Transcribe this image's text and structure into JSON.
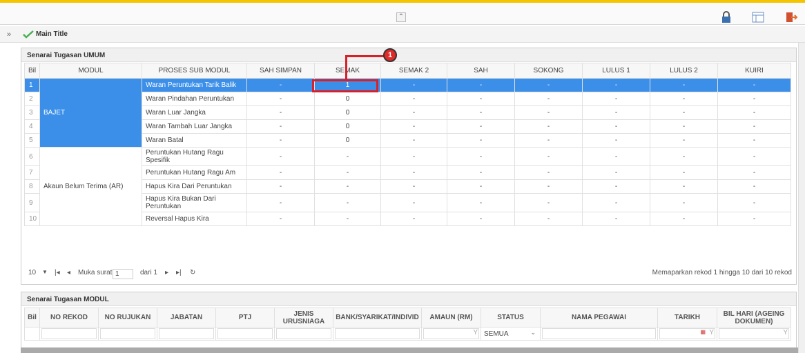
{
  "topbar": {
    "collapse_icon": "double-chevron-up-icon",
    "icons": [
      "lock-icon",
      "layout-icon",
      "logout-icon"
    ]
  },
  "titlebar": {
    "title": "Main Title",
    "expand_glyph": "»"
  },
  "panel1": {
    "title": "Senarai Tugasan UMUM",
    "headers": [
      "Bil",
      "MODUL",
      "PROSES SUB MODUL",
      "SAH SIMPAN",
      "SEMAK",
      "SEMAK 2",
      "SAH",
      "SOKONG",
      "LULUS 1",
      "LULUS 2",
      "KUIRI"
    ],
    "groups": [
      {
        "name": "BAJET"
      },
      {
        "name": "Akaun Belum Terima (AR)"
      }
    ],
    "rows": [
      {
        "bil": "1",
        "proses": "Waran Peruntukan Tarik Balik",
        "vals": [
          "-",
          "1",
          "-",
          "-",
          "-",
          "-",
          "-",
          "-"
        ]
      },
      {
        "bil": "2",
        "proses": "Waran Pindahan Peruntukan",
        "vals": [
          "-",
          "0",
          "-",
          "-",
          "-",
          "-",
          "-",
          "-"
        ]
      },
      {
        "bil": "3",
        "proses": "Waran Luar Jangka",
        "vals": [
          "-",
          "0",
          "-",
          "-",
          "-",
          "-",
          "-",
          "-"
        ]
      },
      {
        "bil": "4",
        "proses": "Waran Tambah Luar Jangka",
        "vals": [
          "-",
          "0",
          "-",
          "-",
          "-",
          "-",
          "-",
          "-"
        ]
      },
      {
        "bil": "5",
        "proses": "Waran Batal",
        "vals": [
          "-",
          "0",
          "-",
          "-",
          "-",
          "-",
          "-",
          "-"
        ]
      },
      {
        "bil": "6",
        "proses": "Peruntukan Hutang Ragu Spesifik",
        "vals": [
          "-",
          "-",
          "-",
          "-",
          "-",
          "-",
          "-",
          "-"
        ]
      },
      {
        "bil": "7",
        "proses": "Peruntukan Hutang Ragu Am",
        "vals": [
          "-",
          "-",
          "-",
          "-",
          "-",
          "-",
          "-",
          "-"
        ]
      },
      {
        "bil": "8",
        "proses": "Hapus Kira Dari Peruntukan",
        "vals": [
          "-",
          "-",
          "-",
          "-",
          "-",
          "-",
          "-",
          "-"
        ]
      },
      {
        "bil": "9",
        "proses": "Hapus Kira Bukan Dari Peruntukan",
        "vals": [
          "-",
          "-",
          "-",
          "-",
          "-",
          "-",
          "-",
          "-"
        ]
      },
      {
        "bil": "10",
        "proses": "Reversal Hapus Kira",
        "vals": [
          "-",
          "-",
          "-",
          "-",
          "-",
          "-",
          "-",
          "-"
        ]
      }
    ],
    "pager": {
      "page_size": "10",
      "page_label": "Muka surat",
      "page": "1",
      "of_label": "dari 1",
      "record_info": "Memaparkan rekod 1 hingga 10 dari 10 rekod"
    }
  },
  "callout": {
    "number": "1"
  },
  "panel2": {
    "title": "Senarai Tugasan MODUL",
    "headers": [
      "Bil",
      "NO REKOD",
      "NO RUJUKAN",
      "JABATAN",
      "PTJ",
      "JENIS URUSNIAGA",
      "BANK/SYARIKAT/INDIVID",
      "AMAUN (RM)",
      "STATUS",
      "NAMA PEGAWAI",
      "TARIKH",
      "BIL HARI (AGEING DOKUMEN)"
    ],
    "status_filter": "SEMUA"
  }
}
